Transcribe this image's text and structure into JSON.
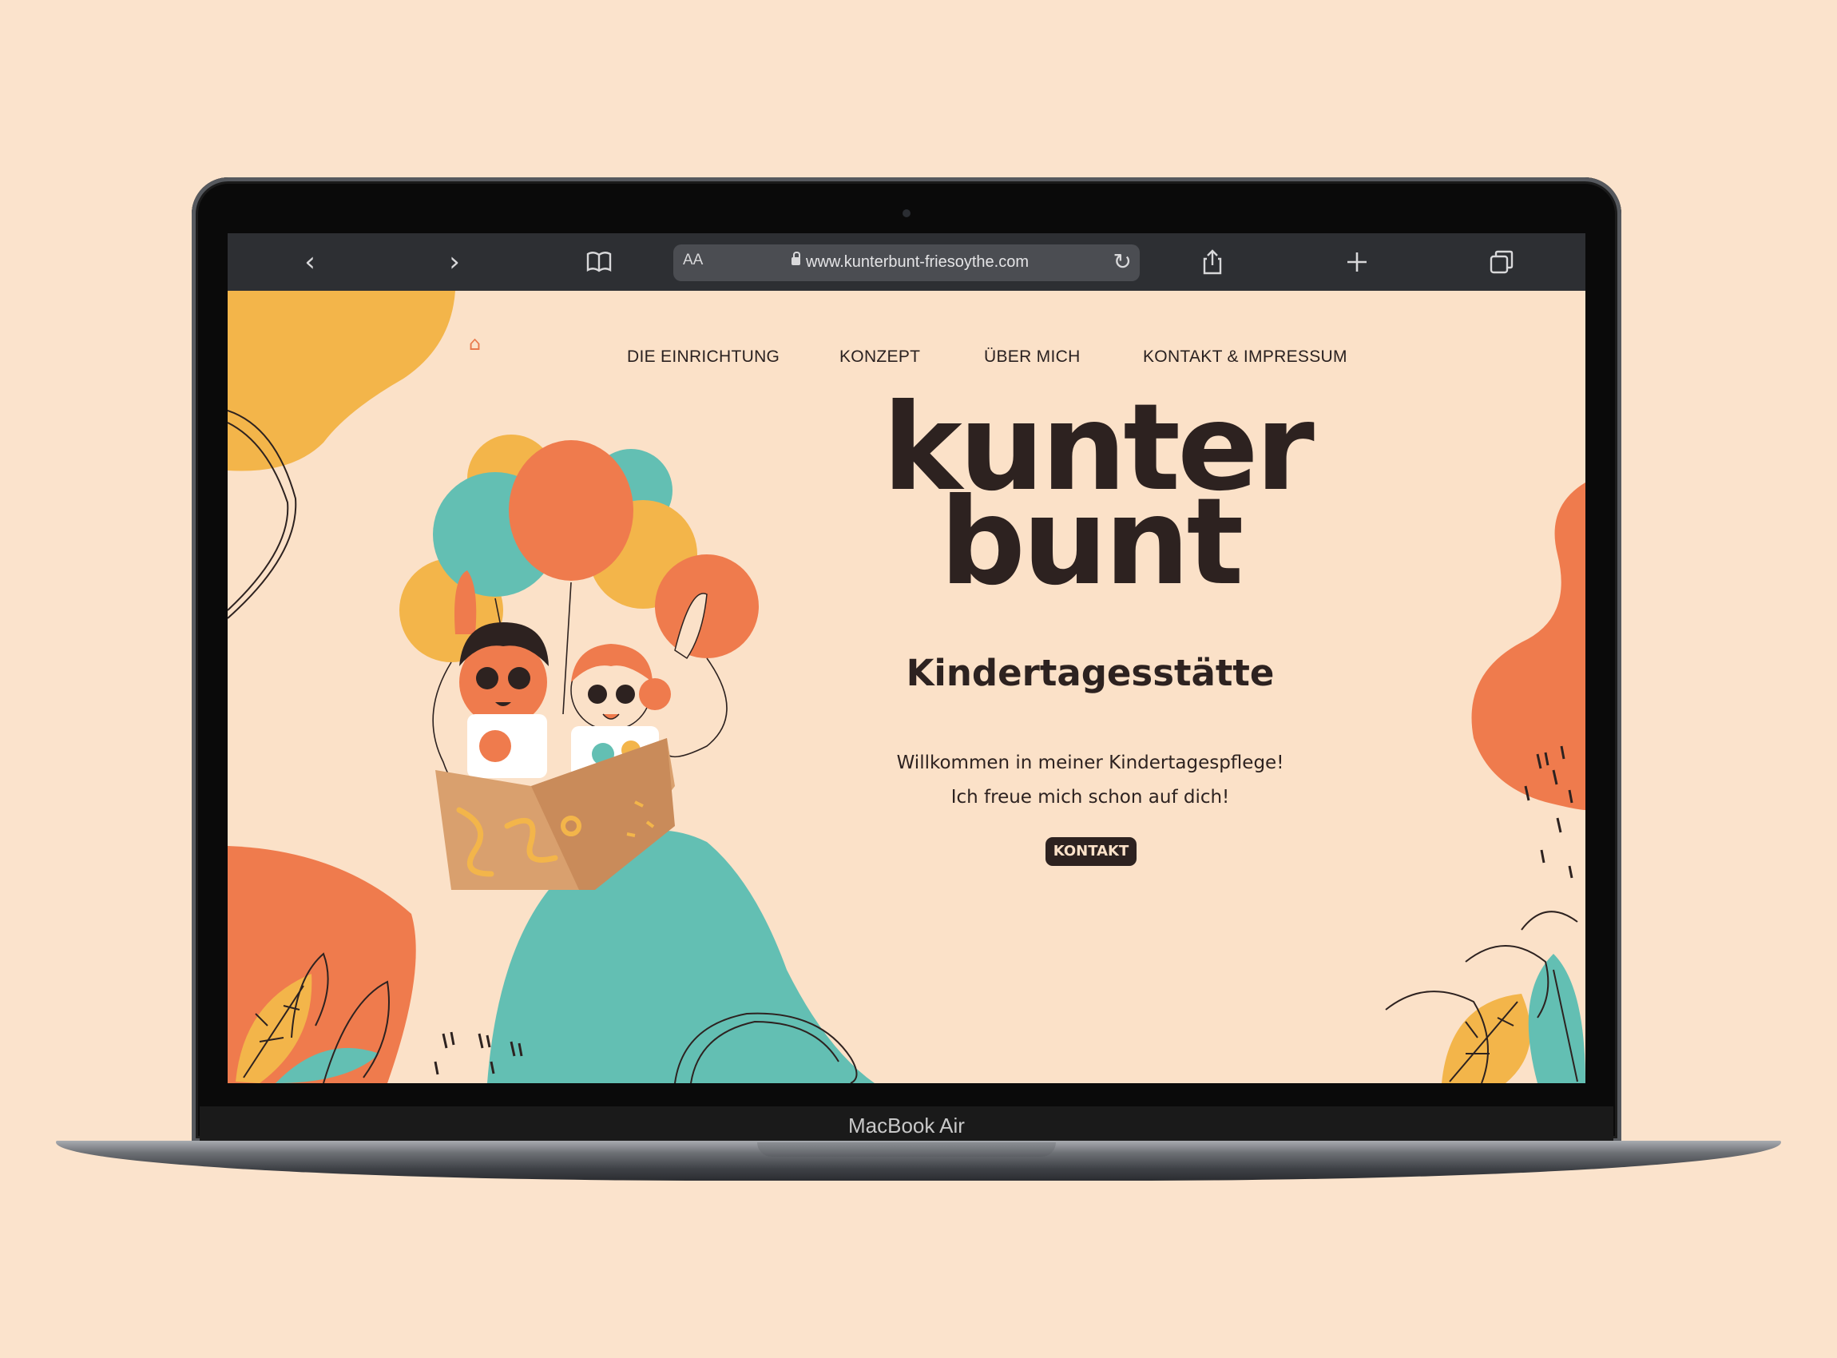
{
  "browser": {
    "reader_label": "AA",
    "url": "www.kunterbunt-friesoythe.com",
    "icons": [
      "back-icon",
      "forward-icon",
      "bookmarks-icon",
      "lock-icon",
      "reload-icon",
      "share-icon",
      "new-tab-icon",
      "tabs-icon"
    ]
  },
  "nav": {
    "home_icon": "home-icon",
    "items": [
      {
        "label": "DIE EINRICHTUNG"
      },
      {
        "label": "KONZEPT"
      },
      {
        "label": "ÜBER MICH"
      },
      {
        "label": "KONTAKT & IMPRESSUM"
      }
    ]
  },
  "hero": {
    "brand_line1": "kunter",
    "brand_line2": "bunt",
    "subtitle": "Kindertagesstätte",
    "welcome_line1": "Willkommen in meiner Kindertagespflege!",
    "welcome_line2": "Ich freue mich schon auf dich!",
    "cta_label": "KONTAKT"
  },
  "device": {
    "label": "MacBook Air"
  },
  "colors": {
    "background": "#fbe3cc",
    "orange": "#ef7b4d",
    "yellow": "#f3b54a",
    "teal": "#63bfb3",
    "dark": "#2d2220"
  }
}
